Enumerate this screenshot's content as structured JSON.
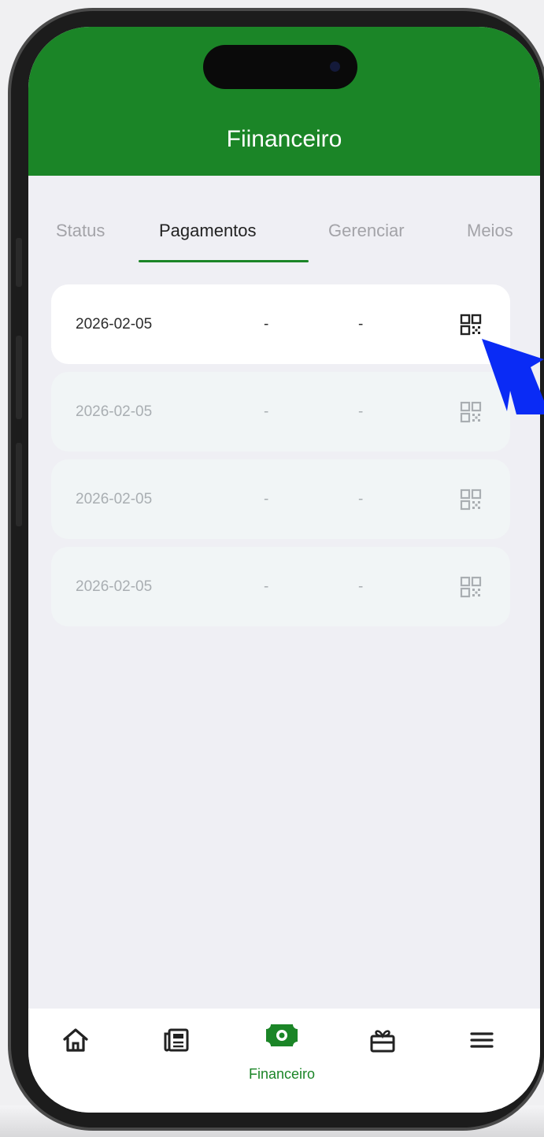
{
  "header": {
    "title": "Fiinanceiro"
  },
  "tabs": [
    {
      "label": "Status",
      "active": false
    },
    {
      "label": "Pagamentos",
      "active": true
    },
    {
      "label": "Gerenciar",
      "active": false
    },
    {
      "label": "Meios",
      "active": false
    }
  ],
  "payments": [
    {
      "date": "2026-02-05",
      "col2": "-",
      "col3": "-",
      "icon": "qr-code-icon",
      "selected": true
    },
    {
      "date": "2026-02-05",
      "col2": "-",
      "col3": "-",
      "icon": "qr-code-icon",
      "selected": false
    },
    {
      "date": "2026-02-05",
      "col2": "-",
      "col3": "-",
      "icon": "qr-code-icon",
      "selected": false
    },
    {
      "date": "2026-02-05",
      "col2": "-",
      "col3": "-",
      "icon": "qr-code-icon",
      "selected": false
    }
  ],
  "bottom_nav": {
    "items": [
      {
        "icon": "home-icon"
      },
      {
        "icon": "newspaper-icon"
      },
      {
        "icon": "money-icon",
        "label": "Financeiro",
        "active": true
      },
      {
        "icon": "gift-icon"
      },
      {
        "icon": "menu-icon"
      }
    ]
  },
  "colors": {
    "brand": "#1b8527",
    "cursor": "#0a2bf5"
  }
}
